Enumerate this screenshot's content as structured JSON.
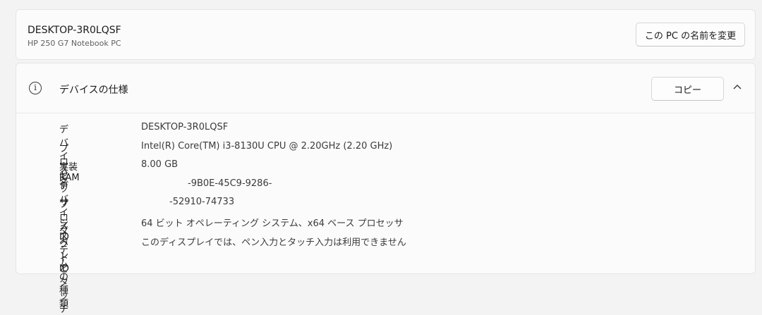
{
  "device_card": {
    "name": "DESKTOP-3R0LQSF",
    "model": "HP 250 G7 Notebook PC",
    "rename_label": "この PC の名前を変更"
  },
  "specs": {
    "title": "デバイスの仕様",
    "copy_label": "コピー",
    "rows": [
      {
        "label": "デバイス名",
        "value": "DESKTOP-3R0LQSF"
      },
      {
        "label": "プロセッサ",
        "value": "Intel(R) Core(TM) i3-8130U CPU @ 2.20GHz (2.20 GHz)"
      },
      {
        "label": "実装 RAM",
        "value": "8.00 GB"
      },
      {
        "label": "デバイス ID",
        "value": "-9B0E-45C9-9286-"
      },
      {
        "label": "プロダクト ID",
        "value": "-52910-74733"
      },
      {
        "label": "システムの種類",
        "value": "64 ビット オペレーティング システム、x64 ベース プロセッサ"
      },
      {
        "label": "ペンとタッチ",
        "value": "このディスプレイでは、ペン入力とタッチ入力は利用できません"
      }
    ]
  }
}
